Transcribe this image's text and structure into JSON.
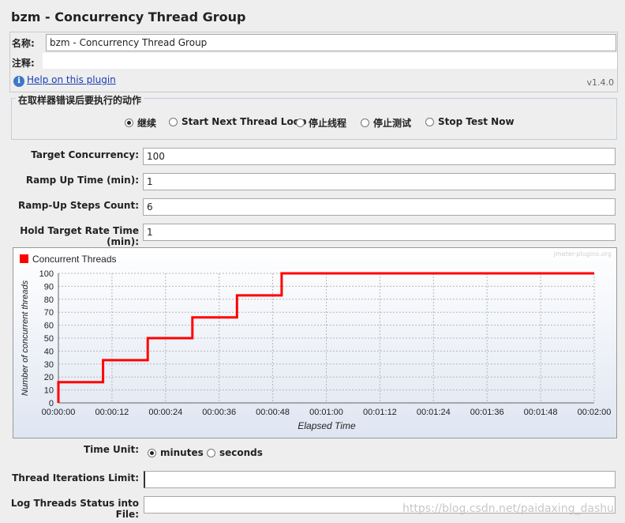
{
  "window": {
    "title": "bzm - Concurrency Thread Group"
  },
  "name_row": {
    "label": "名称:",
    "value": "bzm - Concurrency Thread Group"
  },
  "comment_row": {
    "label": "注释:",
    "value": ""
  },
  "help": {
    "link_text": "Help on this plugin",
    "version": "v1.4.0"
  },
  "error_action": {
    "title": "在取样器错误后要执行的动作",
    "options": [
      {
        "label": "继续",
        "selected": true
      },
      {
        "label": "Start Next Thread Loop",
        "selected": false
      },
      {
        "label": "停止线程",
        "selected": false
      },
      {
        "label": "停止测试",
        "selected": false
      },
      {
        "label": "Stop Test Now",
        "selected": false
      }
    ]
  },
  "params": {
    "target_concurrency": {
      "label": "Target Concurrency:",
      "value": "100"
    },
    "ramp_up_time": {
      "label": "Ramp Up Time (min):",
      "value": "1"
    },
    "ramp_up_steps": {
      "label": "Ramp-Up Steps Count:",
      "value": "6"
    },
    "hold_time": {
      "label": "Hold Target Rate Time (min):",
      "value": "1"
    }
  },
  "chart_data": {
    "type": "line",
    "legend": "Concurrent Threads",
    "watermark": "jmeter-plugins.org",
    "xlabel": "Elapsed Time",
    "ylabel": "Number of concurrent threads",
    "x_tick_labels": [
      "00:00:00",
      "00:00:12",
      "00:00:24",
      "00:00:36",
      "00:00:48",
      "00:01:00",
      "00:01:12",
      "00:01:24",
      "00:01:36",
      "00:01:48",
      "00:02:00"
    ],
    "y_tick_labels": [
      "0",
      "10",
      "20",
      "30",
      "40",
      "50",
      "60",
      "70",
      "80",
      "90",
      "100"
    ],
    "xlim": [
      0,
      120
    ],
    "ylim": [
      0,
      100
    ],
    "x_unit": "seconds",
    "series": [
      {
        "name": "Concurrent Threads",
        "color": "#ff0000",
        "points": [
          [
            0,
            0
          ],
          [
            0,
            16
          ],
          [
            10,
            16
          ],
          [
            10,
            33
          ],
          [
            20,
            33
          ],
          [
            20,
            50
          ],
          [
            30,
            50
          ],
          [
            30,
            66
          ],
          [
            40,
            66
          ],
          [
            40,
            83
          ],
          [
            50,
            83
          ],
          [
            50,
            100
          ],
          [
            120,
            100
          ]
        ]
      }
    ],
    "grid": true
  },
  "time_unit": {
    "label": "Time Unit:",
    "options": [
      {
        "label": "minutes",
        "selected": true
      },
      {
        "label": "seconds",
        "selected": false
      }
    ]
  },
  "iterations": {
    "label": "Thread Iterations Limit:",
    "value": ""
  },
  "log_status": {
    "label": "Log Threads Status into File:",
    "value": ""
  },
  "footer_watermark": "https://blog.csdn.net/paidaxing_dashu"
}
